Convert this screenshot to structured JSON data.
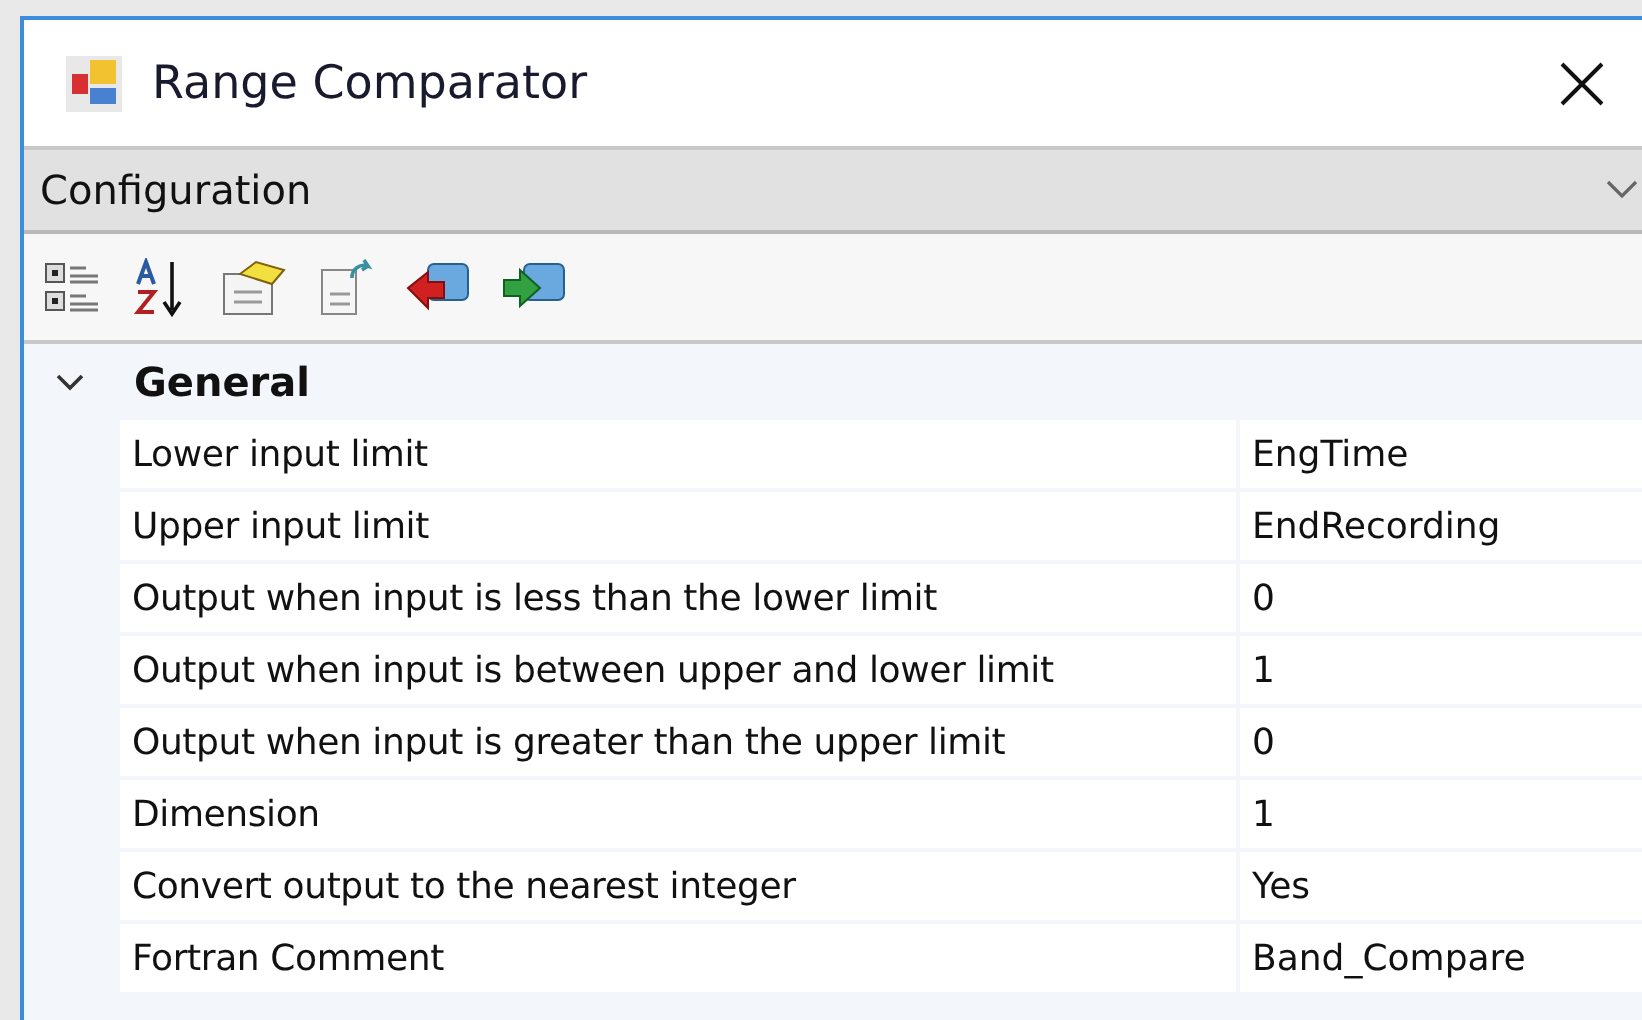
{
  "window": {
    "title": "Range Comparator"
  },
  "object_selector": {
    "value": "Configuration"
  },
  "categories": [
    {
      "name": "General",
      "expanded": true,
      "properties": [
        {
          "name": "Lower input limit",
          "value": "EngTime"
        },
        {
          "name": "Upper input limit",
          "value": "EndRecording"
        },
        {
          "name": "Output when input is less than the lower limit",
          "value": "0"
        },
        {
          "name": "Output when input is between upper and lower limit",
          "value": "1"
        },
        {
          "name": "Output when input is greater than the upper limit",
          "value": "0"
        },
        {
          "name": "Dimension",
          "value": "1"
        },
        {
          "name": "Convert output to the nearest integer",
          "value": "Yes"
        },
        {
          "name": "Fortran Comment",
          "value": "Band_Compare"
        }
      ]
    }
  ]
}
